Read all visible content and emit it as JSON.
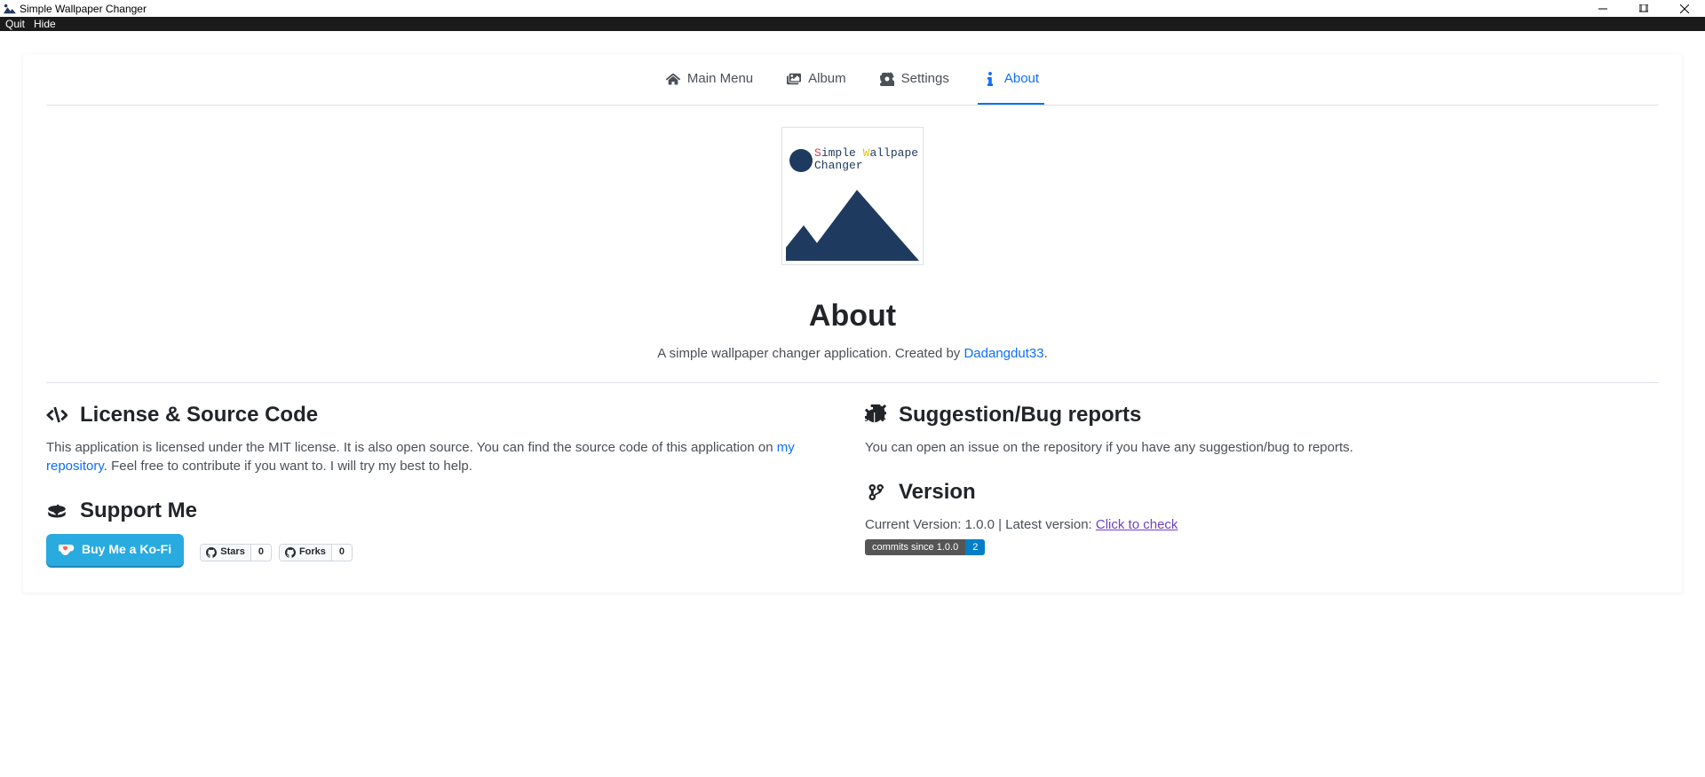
{
  "window": {
    "title": "Simple Wallpaper Changer"
  },
  "menubar": {
    "quit": "Quit",
    "hide": "Hide"
  },
  "tabs": {
    "main_menu": "Main Menu",
    "album": "Album",
    "settings": "Settings",
    "about": "About"
  },
  "logo": {
    "line1_s": "S",
    "line1_imple": "imple ",
    "line1_w": "W",
    "line1_allpaper": "allpaper",
    "line2": "Changer"
  },
  "about": {
    "heading": "About",
    "sub_prefix": "A simple wallpaper changer application. Created by ",
    "author": "Dadangdut33",
    "sub_suffix": "."
  },
  "license": {
    "title": "License & Source Code",
    "p1": "This application is licensed under the MIT license. It is also open source. You can find the source code of this application on ",
    "repo_link": "my repository",
    "p2": ". Feel free to contribute if you want to. I will try my best to help."
  },
  "suggestion": {
    "title": "Suggestion/Bug reports",
    "body": "You can open an issue on the repository if you have any suggestion/bug to reports."
  },
  "support": {
    "title": "Support Me",
    "kofi_label": "Buy Me a Ko-Fi",
    "stars_label": "Stars",
    "stars_count": "0",
    "forks_label": "Forks",
    "forks_count": "0"
  },
  "version": {
    "title": "Version",
    "current_prefix": "Current Version: ",
    "current": "1.0.0",
    "sep": " | ",
    "latest_prefix": "Latest version: ",
    "check_link": "Click to check",
    "commits_label": "commits since 1.0.0",
    "commits_count": "2"
  }
}
